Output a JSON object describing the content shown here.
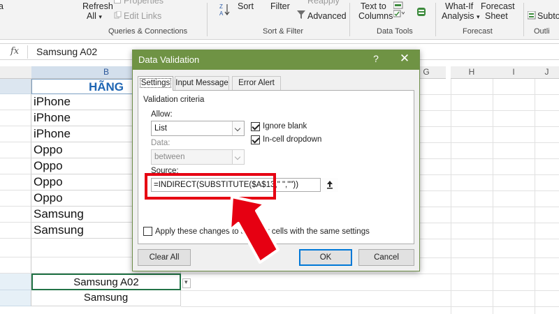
{
  "ribbon": {
    "refresh_label": "Refresh",
    "refresh_all_label": "All",
    "properties_label": "Properties",
    "edit_links_label": "Edit Links",
    "queries_group": "Queries & Connections",
    "sort_label": "Sort",
    "filter_label": "Filter",
    "reapply_label": "Reapply",
    "advanced_label": "Advanced",
    "sort_filter_group": "Sort & Filter",
    "text_to_label": "Text to",
    "columns_label": "Columns",
    "data_tools_group": "Data Tools",
    "what_if_label": "What-If",
    "analysis_label": "Analysis",
    "forecast_label": "Forecast",
    "sheet_label": "Sheet",
    "forecast_group": "Forecast",
    "subtotal_label": "Subtot",
    "outline_label": "Outli",
    "left_edge_label": "a"
  },
  "formula_bar": {
    "fx_label": "fx",
    "value": "Samsung A02"
  },
  "grid": {
    "columns": [
      "B",
      "G",
      "H",
      "I",
      "J"
    ],
    "header_cell": "HÃNG",
    "cells": [
      "iPhone",
      "iPhone",
      "iPhone",
      "Oppo",
      "Oppo",
      "Oppo",
      "Oppo",
      "Samsung",
      "Samsung"
    ],
    "cell_a02": "Samsung A02",
    "cell_samsung": "Samsung"
  },
  "dialog": {
    "title": "Data Validation",
    "help": "?",
    "close": "✕",
    "tabs": [
      "Settings",
      "Input Message",
      "Error Alert"
    ],
    "group_title": "Validation criteria",
    "allow_label": "Allow:",
    "allow_value": "List",
    "ignore_blank_label": "Ignore blank",
    "ignore_blank_checked": true,
    "in_cell_dropdown_label": "In-cell dropdown",
    "in_cell_dropdown_checked": true,
    "data_label": "Data:",
    "data_value": "between",
    "source_label": "Source:",
    "source_value": "=INDIRECT(SUBSTITUTE($A$13,\" \",\"\"))",
    "apply_label": "Apply these changes to all other cells with the same settings",
    "clear_all_label": "Clear All",
    "ok_label": "OK",
    "cancel_label": "Cancel"
  },
  "colors": {
    "dialog_title_bar": "#6f9344",
    "highlight": "#e60012",
    "header_text": "#1f66b3"
  }
}
